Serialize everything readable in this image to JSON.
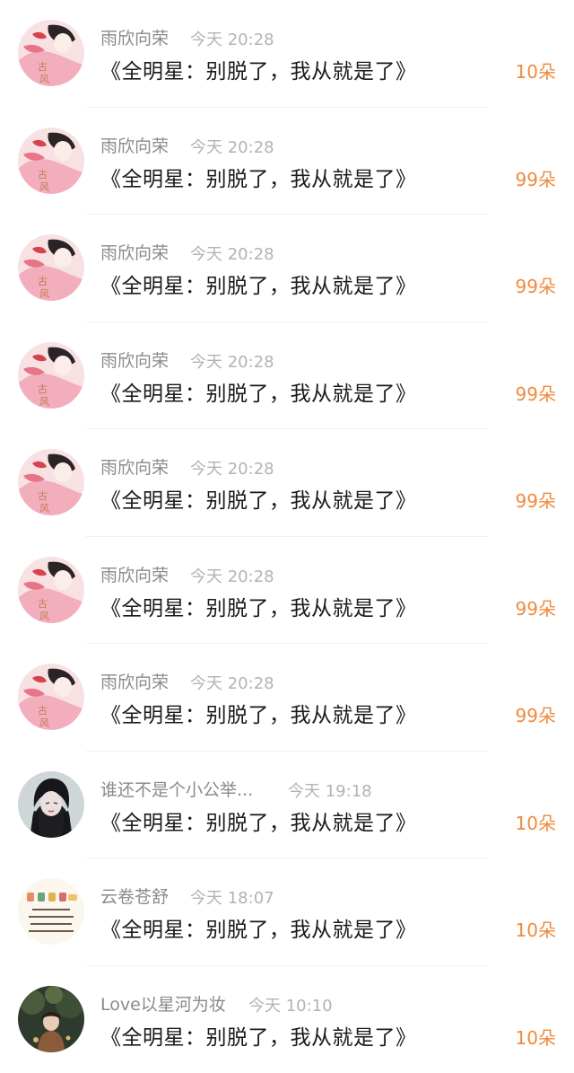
{
  "comments": [
    {
      "user": "雨欣向荣",
      "time": "今天 20:28",
      "text": "《全明星：别脱了，我从就是了》",
      "count": "10朵",
      "avatar": "avatar-gufeng"
    },
    {
      "user": "雨欣向荣",
      "time": "今天 20:28",
      "text": "《全明星：别脱了，我从就是了》",
      "count": "99朵",
      "avatar": "avatar-gufeng"
    },
    {
      "user": "雨欣向荣",
      "time": "今天 20:28",
      "text": "《全明星：别脱了，我从就是了》",
      "count": "99朵",
      "avatar": "avatar-gufeng"
    },
    {
      "user": "雨欣向荣",
      "time": "今天 20:28",
      "text": "《全明星：别脱了，我从就是了》",
      "count": "99朵",
      "avatar": "avatar-gufeng"
    },
    {
      "user": "雨欣向荣",
      "time": "今天 20:28",
      "text": "《全明星：别脱了，我从就是了》",
      "count": "99朵",
      "avatar": "avatar-gufeng"
    },
    {
      "user": "雨欣向荣",
      "time": "今天 20:28",
      "text": "《全明星：别脱了，我从就是了》",
      "count": "99朵",
      "avatar": "avatar-gufeng"
    },
    {
      "user": "雨欣向荣",
      "time": "今天 20:28",
      "text": "《全明星：别脱了，我从就是了》",
      "count": "99朵",
      "avatar": "avatar-gufeng"
    },
    {
      "user": "谁还不是个小公举...",
      "time": "今天 19:18",
      "text": "《全明星：别脱了，我从就是了》",
      "count": "10朵",
      "avatar": "avatar-dark-girl"
    },
    {
      "user": "云卷苍舒",
      "time": "今天 18:07",
      "text": "《全明星：别脱了，我从就是了》",
      "count": "10朵",
      "avatar": "avatar-todo-list"
    },
    {
      "user": "Love以星河为妆",
      "time": "今天 10:10",
      "text": "《全明星：别脱了，我从就是了》",
      "count": "10朵",
      "avatar": "avatar-forest-girl"
    }
  ],
  "colors": {
    "count": "#f08a3c",
    "name": "#8a8a8a",
    "time": "#b3b3b3",
    "text": "#1a1a1a"
  }
}
